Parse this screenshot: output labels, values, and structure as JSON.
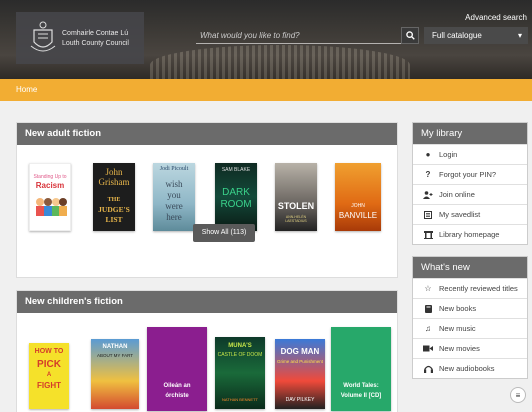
{
  "header": {
    "council_line1": "Comhairle Contae Lú",
    "council_line2": "Louth County Council",
    "advanced_search": "Advanced search",
    "search_placeholder": "What would you like to find?",
    "catalogue": "Full catalogue"
  },
  "breadcrumb": {
    "home": "Home"
  },
  "adult": {
    "title": "New adult fiction",
    "show_all": "Show All (113)",
    "books": [
      {
        "l1": "Standing Up to",
        "l2": "Racism"
      },
      {
        "l1": "John",
        "l2": "Grisham",
        "l3": "THE",
        "l4": "JUDGE'S",
        "l5": "LIST"
      },
      {
        "l1": "Jodi Picoult",
        "l2": "wish",
        "l3": "you",
        "l4": "were",
        "l5": "here"
      },
      {
        "l1": "SAM BLAKE",
        "l2": "DARK",
        "l3": "ROOM"
      },
      {
        "l1": "STOLEN",
        "l2": "ANN-HELÉN LAESTADIUS"
      },
      {
        "l1": "JOHN",
        "l2": "BANVILLE"
      }
    ]
  },
  "children": {
    "title": "New children's fiction",
    "books": [
      {
        "l1": "HOW TO",
        "l2": "PICK",
        "l3": "A",
        "l4": "FIGHT"
      },
      {
        "l1": "NATHAN",
        "l2": "ABOUT MY FART"
      },
      {
        "l1": "Oileán an",
        "l2": "órchiste"
      },
      {
        "l1": "MUNA'S",
        "l2": "CASTLE OF DOOM",
        "l3": "NATHAN BENNETT"
      },
      {
        "l1": "DOG MAN",
        "l2": "Grime and Punishment",
        "l3": "DAV PILKEY"
      },
      {
        "l1": "World Tales:",
        "l2": "Volume II [CD]"
      }
    ]
  },
  "my_library": {
    "title": "My library",
    "items": [
      {
        "label": "Login",
        "icon": "user-circle-icon"
      },
      {
        "label": "Forgot your PIN?",
        "icon": "question-icon"
      },
      {
        "label": "Join online",
        "icon": "user-plus-icon"
      },
      {
        "label": "My savedlist",
        "icon": "list-icon"
      },
      {
        "label": "Library homepage",
        "icon": "building-icon"
      }
    ]
  },
  "whats_new": {
    "title": "What's new",
    "items": [
      {
        "label": "Recently reviewed titles",
        "icon": "star-icon"
      },
      {
        "label": "New books",
        "icon": "book-icon"
      },
      {
        "label": "New music",
        "icon": "music-icon"
      },
      {
        "label": "New movies",
        "icon": "video-icon"
      },
      {
        "label": "New audiobooks",
        "icon": "headphones-icon"
      }
    ]
  },
  "colors": {
    "accent": "#f2ad33",
    "panel_head": "#6b6b6b"
  }
}
